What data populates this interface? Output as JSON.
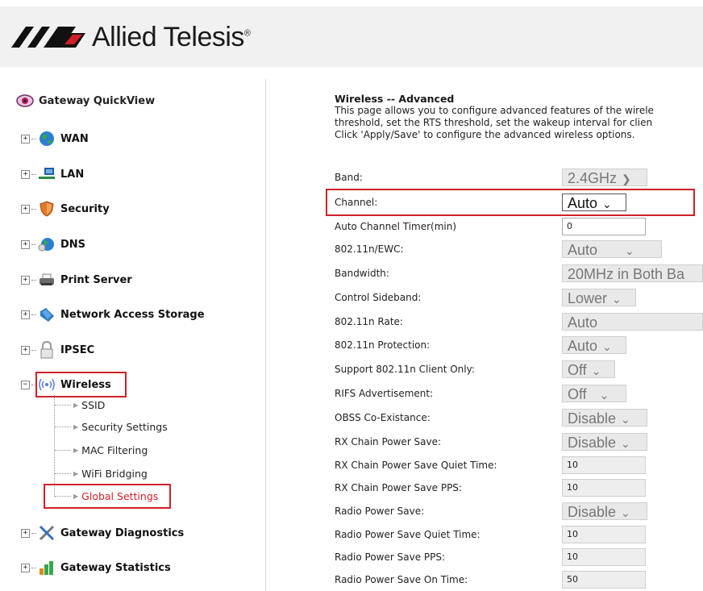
{
  "brand": {
    "name": "Allied Telesis",
    "tm": "®"
  },
  "nav": {
    "quickview": "Gateway QuickView",
    "items": [
      {
        "label": "WAN"
      },
      {
        "label": "LAN"
      },
      {
        "label": "Security"
      },
      {
        "label": "DNS"
      },
      {
        "label": "Print Server"
      },
      {
        "label": "Network Access Storage"
      },
      {
        "label": "IPSEC"
      },
      {
        "label": "Wireless"
      },
      {
        "label": "Gateway Diagnostics"
      },
      {
        "label": "Gateway Statistics"
      }
    ],
    "wireless_sub": [
      {
        "label": "SSID"
      },
      {
        "label": "Security Settings"
      },
      {
        "label": "MAC Filtering"
      },
      {
        "label": "WiFi Bridging"
      },
      {
        "label": "Global Settings"
      }
    ]
  },
  "page": {
    "title": "Wireless -- Advanced",
    "desc1": "This page allows you to configure advanced features of the wirele",
    "desc2": "threshold, set the RTS threshold, set the wakeup interval for clien",
    "desc3": "Click 'Apply/Save' to configure the advanced wireless options."
  },
  "settings": [
    {
      "label": "Band:",
      "value": "2.4GHz"
    },
    {
      "label": "Channel:",
      "value": "Auto"
    },
    {
      "label": "Auto Channel Timer(min)",
      "value": "0"
    },
    {
      "label": "802.11n/EWC:",
      "value": "Auto"
    },
    {
      "label": "Bandwidth:",
      "value": "20MHz in Both Ba"
    },
    {
      "label": "Control Sideband:",
      "value": "Lower"
    },
    {
      "label": "802.11n Rate:",
      "value": "Auto"
    },
    {
      "label": "802.11n Protection:",
      "value": "Auto"
    },
    {
      "label": "Support 802.11n Client Only:",
      "value": "Off"
    },
    {
      "label": "RIFS Advertisement:",
      "value": "Off"
    },
    {
      "label": "OBSS Co-Existance:",
      "value": "Disable"
    },
    {
      "label": "RX Chain Power Save:",
      "value": "Disable"
    },
    {
      "label": "RX Chain Power Save Quiet Time:",
      "value": "10"
    },
    {
      "label": "RX Chain Power Save PPS:",
      "value": "10"
    },
    {
      "label": "Radio Power Save:",
      "value": "Disable"
    },
    {
      "label": "Radio Power Save Quiet Time:",
      "value": "10"
    },
    {
      "label": "Radio Power Save PPS:",
      "value": "10"
    },
    {
      "label": "Radio Power Save On Time:",
      "value": "50"
    }
  ],
  "colors": {
    "highlight": "#d0202a",
    "disabled_bg": "#e9e9e9"
  }
}
